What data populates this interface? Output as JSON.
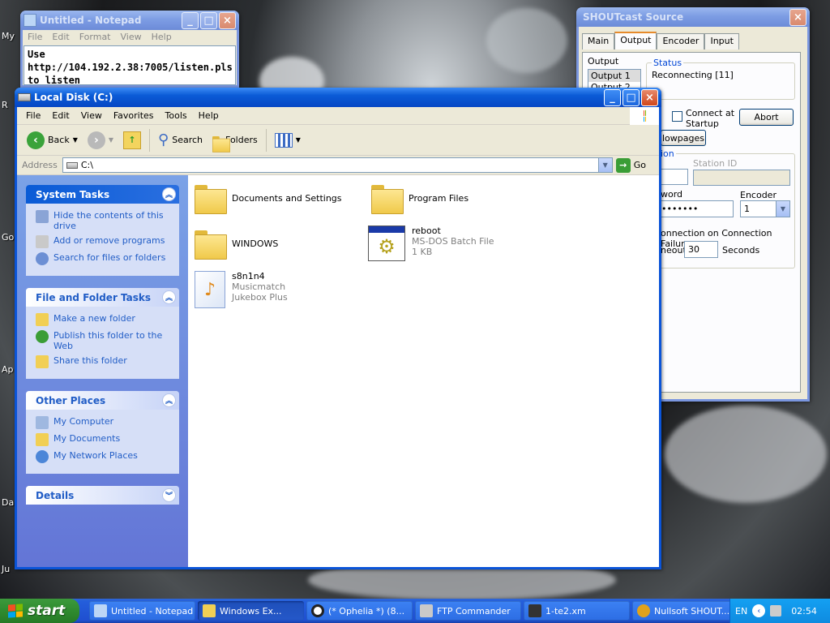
{
  "desktop": {
    "labels": [
      "My",
      "R",
      "Go",
      "Ap",
      "Da",
      "Ju"
    ]
  },
  "notepad": {
    "title": "Untitled - Notepad",
    "menu": [
      "File",
      "Edit",
      "Format",
      "View",
      "Help"
    ],
    "text_lines": [
      "Use",
      "http://104.192.2.38:7005/listen.pls",
      "to listen"
    ]
  },
  "shoutcast": {
    "title": "SHOUTcast Source",
    "tabs": [
      "Main",
      "Output",
      "Encoder",
      "Input"
    ],
    "output_label": "Output",
    "outputs": [
      "Output 1",
      "Output 2"
    ],
    "status_label": "Status",
    "status_value": "Reconnecting [11]",
    "connect_at_startup": "Connect at Startup",
    "abort_button": "Abort",
    "yellowpages_button": "lowpages",
    "connection_group": "ion",
    "station_id_label": "Station ID",
    "password_label": "word",
    "password_value": "•••••••",
    "encoder_label": "Encoder",
    "encoder_value": "1",
    "reconnect_label": "onnection on Connection Failure",
    "timeout_label": "neout",
    "timeout_value": "30",
    "seconds_label": "Seconds"
  },
  "explorer": {
    "title": "Local Disk (C:)",
    "menu": [
      "File",
      "Edit",
      "View",
      "Favorites",
      "Tools",
      "Help"
    ],
    "toolbar": {
      "back": "Back",
      "search": "Search",
      "folders": "Folders"
    },
    "address_label": "Address",
    "address_value": "C:\\",
    "go_label": "Go",
    "system_tasks": {
      "title": "System Tasks",
      "items": [
        "Hide the contents of this drive",
        "Add or remove programs",
        "Search for files or folders"
      ]
    },
    "file_folder_tasks": {
      "title": "File and Folder Tasks",
      "items": [
        "Make a new folder",
        "Publish this folder to the Web",
        "Share this folder"
      ]
    },
    "other_places": {
      "title": "Other Places",
      "items": [
        "My Computer",
        "My Documents",
        "My Network Places"
      ]
    },
    "details": {
      "title": "Details"
    },
    "files": [
      {
        "name": "Documents and Settings",
        "type": "folder"
      },
      {
        "name": "Program Files",
        "type": "folder"
      },
      {
        "name": "WINDOWS",
        "type": "folder"
      },
      {
        "name": "reboot",
        "sub1": "MS-DOS Batch File",
        "sub2": "1 KB",
        "type": "batch"
      },
      {
        "name": "s8n1n4",
        "sub1": "Musicmatch",
        "sub2": "Jukebox Plus",
        "type": "music"
      }
    ]
  },
  "taskbar": {
    "start_label": "start",
    "tasks": [
      "Untitled - Notepad",
      "Windows Ex...",
      "(* Ophelia *) (8...",
      "FTP Commander",
      "1-te2.xm",
      "Nullsoft SHOUT..."
    ],
    "tray_lang": "EN",
    "clock": "02:54"
  },
  "colors": {
    "xp_blue": "#0a54d8",
    "task_link": "#215dc6",
    "start_green": "#2f8b2f"
  }
}
